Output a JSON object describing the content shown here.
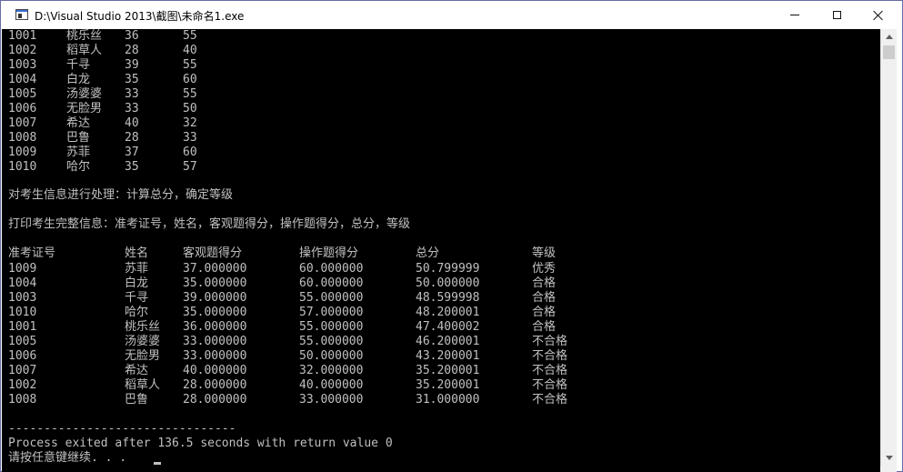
{
  "window": {
    "title": "D:\\Visual Studio 2013\\截图\\未命名1.exe",
    "minimize_icon": "minimize-icon",
    "maximize_icon": "maximize-icon",
    "close_icon": "close-icon"
  },
  "console": {
    "text_color": "#c0c0c0",
    "background": "#000000",
    "initial_rows": [
      [
        "1001",
        "桃乐丝",
        "36",
        "55"
      ],
      [
        "1002",
        "稻草人",
        "28",
        "40"
      ],
      [
        "1003",
        "千寻",
        "39",
        "55"
      ],
      [
        "1004",
        "白龙",
        "35",
        "60"
      ],
      [
        "1005",
        "汤婆婆",
        "33",
        "55"
      ],
      [
        "1006",
        "无脸男",
        "33",
        "50"
      ],
      [
        "1007",
        "希达",
        "40",
        "32"
      ],
      [
        "1008",
        "巴鲁",
        "28",
        "33"
      ],
      [
        "1009",
        "苏菲",
        "37",
        "60"
      ],
      [
        "1010",
        "哈尔",
        "35",
        "57"
      ]
    ],
    "process_msg": "对考生信息进行处理：计算总分，确定等级",
    "print_msg": "打印考生完整信息：准考证号，姓名，客观题得分，操作题得分，总分，等级",
    "table_headers": [
      "准考证号",
      "姓名",
      "客观题得分",
      "操作题得分",
      "总分",
      "等级"
    ],
    "result_rows": [
      [
        "1009",
        "苏菲",
        "37.000000",
        "60.000000",
        "50.799999",
        "优秀"
      ],
      [
        "1004",
        "白龙",
        "35.000000",
        "60.000000",
        "50.000000",
        "合格"
      ],
      [
        "1003",
        "千寻",
        "39.000000",
        "55.000000",
        "48.599998",
        "合格"
      ],
      [
        "1010",
        "哈尔",
        "35.000000",
        "57.000000",
        "48.200001",
        "合格"
      ],
      [
        "1001",
        "桃乐丝",
        "36.000000",
        "55.000000",
        "47.400002",
        "合格"
      ],
      [
        "1005",
        "汤婆婆",
        "33.000000",
        "55.000000",
        "46.200001",
        "不合格"
      ],
      [
        "1006",
        "无脸男",
        "33.000000",
        "50.000000",
        "43.200001",
        "不合格"
      ],
      [
        "1007",
        "希达",
        "40.000000",
        "32.000000",
        "35.200001",
        "不合格"
      ],
      [
        "1002",
        "稻草人",
        "28.000000",
        "40.000000",
        "35.200001",
        "不合格"
      ],
      [
        "1008",
        "巴鲁",
        "28.000000",
        "33.000000",
        "31.000000",
        "不合格"
      ]
    ],
    "separator": "--------------------------------",
    "exit_msg": "Process exited after 136.5 seconds with return value 0",
    "continue_prompt": "请按任意键继续. . ."
  }
}
